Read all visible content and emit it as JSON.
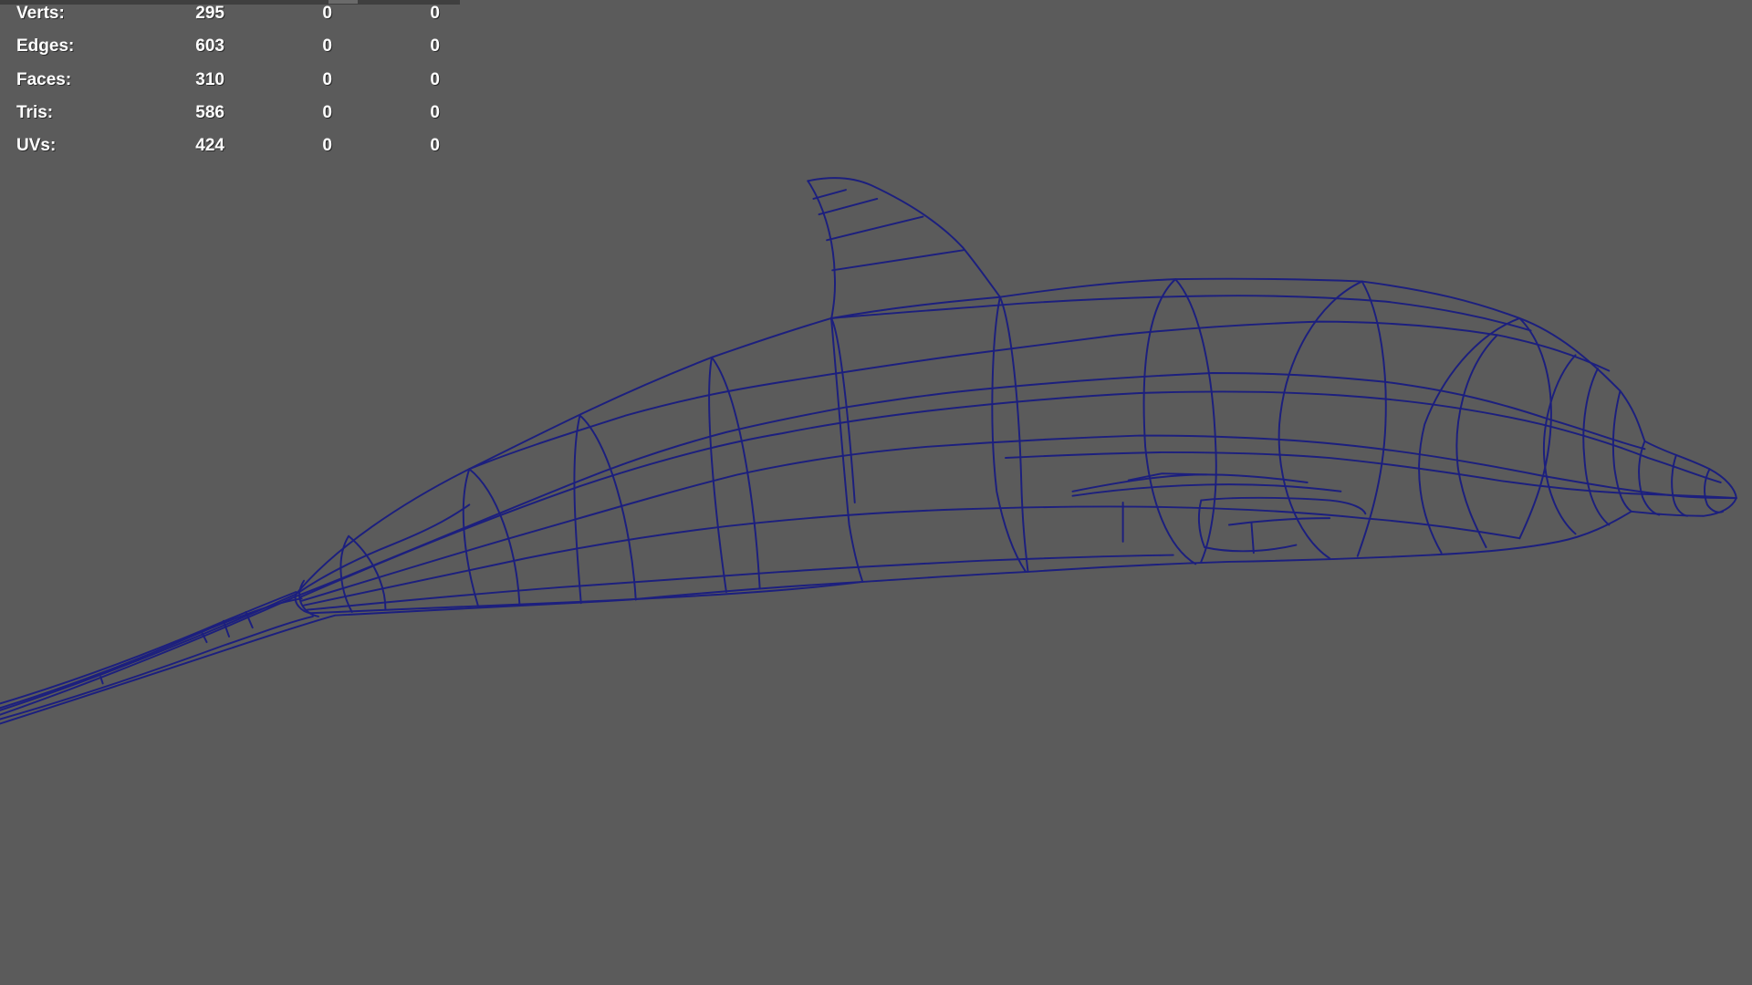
{
  "stats": {
    "rows": [
      {
        "label": "Verts:",
        "values": [
          "295",
          "0",
          "0"
        ]
      },
      {
        "label": "Edges:",
        "values": [
          "603",
          "0",
          "0"
        ]
      },
      {
        "label": "Faces:",
        "values": [
          "310",
          "0",
          "0"
        ]
      },
      {
        "label": "Tris:",
        "values": [
          "586",
          "0",
          "0"
        ]
      },
      {
        "label": "UVs:",
        "values": [
          "424",
          "0",
          "0"
        ]
      }
    ]
  },
  "viewport": {
    "background_color": "#5b5b5b",
    "wireframe_color": "#1c1f7e",
    "object_icon": "dolphin-wireframe-mesh"
  }
}
